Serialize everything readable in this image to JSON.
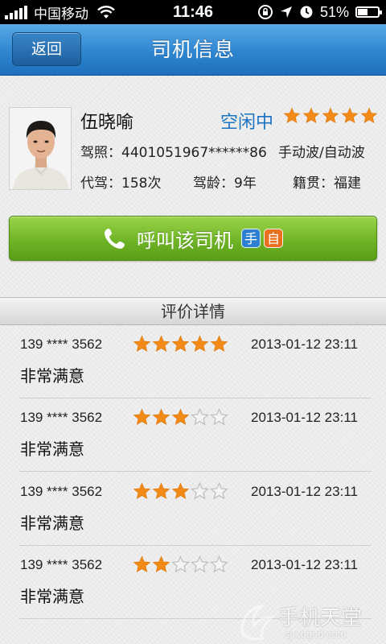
{
  "status_bar": {
    "carrier": "中国移动",
    "time": "11:46",
    "battery": "51%",
    "battery_level": 0.51
  },
  "nav": {
    "back_label": "返回",
    "title": "司机信息"
  },
  "driver": {
    "name": "伍晓喻",
    "status": "空闲中",
    "rating": 5,
    "license": "驾照：4401051967******86",
    "transmission": "手动波/自动波",
    "drives": "代驾：158次",
    "years": "驾龄：9年",
    "hometown": "籍贯：福建"
  },
  "call_button": {
    "label": "呼叫该司机",
    "badge_manual": "手",
    "badge_auto": "自"
  },
  "reviews_title": "评价详情",
  "reviews": [
    {
      "phone": "139 **** 3562",
      "rating": 5,
      "date": "2013-01-12  23:11",
      "comment": "非常满意"
    },
    {
      "phone": "139 **** 3562",
      "rating": 3,
      "date": "2013-01-12  23:11",
      "comment": "非常满意"
    },
    {
      "phone": "139 **** 3562",
      "rating": 3,
      "date": "2013-01-12  23:11",
      "comment": "非常满意"
    },
    {
      "phone": "139 **** 3562",
      "rating": 2,
      "date": "2013-01-12  23:11",
      "comment": "非常满意"
    }
  ],
  "watermark": {
    "text": "手机天堂",
    "url": "sj.xpgod.com"
  },
  "colors": {
    "nav_blue": "#2f86d0",
    "status_blue": "#1a73c0",
    "star_orange": "#f28a18",
    "call_green": "#6fb526"
  }
}
